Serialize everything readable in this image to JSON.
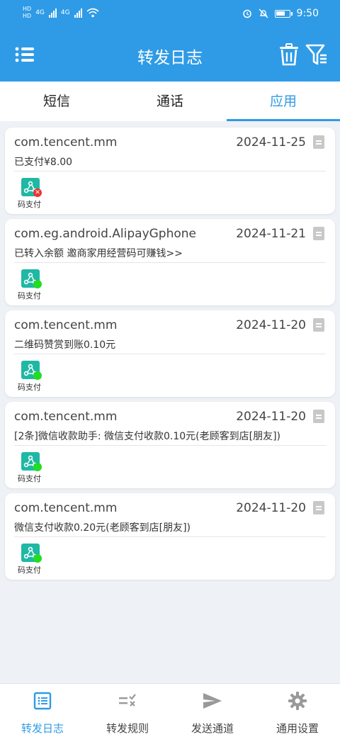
{
  "status_bar": {
    "sim_top": "HD",
    "sim_bottom": "HD",
    "network1": "4G",
    "network2": "4G",
    "time": "9:50"
  },
  "app_bar": {
    "title": "转发日志"
  },
  "tabs": [
    {
      "label": "短信",
      "active": false
    },
    {
      "label": "通话",
      "active": false
    },
    {
      "label": "应用",
      "active": true
    }
  ],
  "colors": {
    "primary": "#2f9be6",
    "app_icon": "#1fb8a4",
    "ok_dot": "#22dd22",
    "error_dot": "#ee3333"
  },
  "logs": [
    {
      "package": "com.tencent.mm",
      "date": "2024-11-25",
      "content": "已支付¥8.00",
      "app_label": "码支付",
      "status": "error"
    },
    {
      "package": "com.eg.android.AlipayGphone",
      "date": "2024-11-21",
      "content": "已转入余额 邀商家用经营码可赚钱>>",
      "app_label": "码支付",
      "status": "ok"
    },
    {
      "package": "com.tencent.mm",
      "date": "2024-11-20",
      "content": "二维码赞赏到账0.10元",
      "app_label": "码支付",
      "status": "ok"
    },
    {
      "package": "com.tencent.mm",
      "date": "2024-11-20",
      "content": "[2条]微信收款助手: 微信支付收款0.10元(老顾客到店[朋友])",
      "app_label": "码支付",
      "status": "ok"
    },
    {
      "package": "com.tencent.mm",
      "date": "2024-11-20",
      "content": "微信支付收款0.20元(老顾客到店[朋友])",
      "app_label": "码支付",
      "status": "ok"
    }
  ],
  "bottom_nav": [
    {
      "label": "转发日志",
      "icon": "list-icon",
      "active": true
    },
    {
      "label": "转发规则",
      "icon": "rules-icon",
      "active": false
    },
    {
      "label": "发送通道",
      "icon": "send-icon",
      "active": false
    },
    {
      "label": "通用设置",
      "icon": "gear-icon",
      "active": false
    }
  ]
}
